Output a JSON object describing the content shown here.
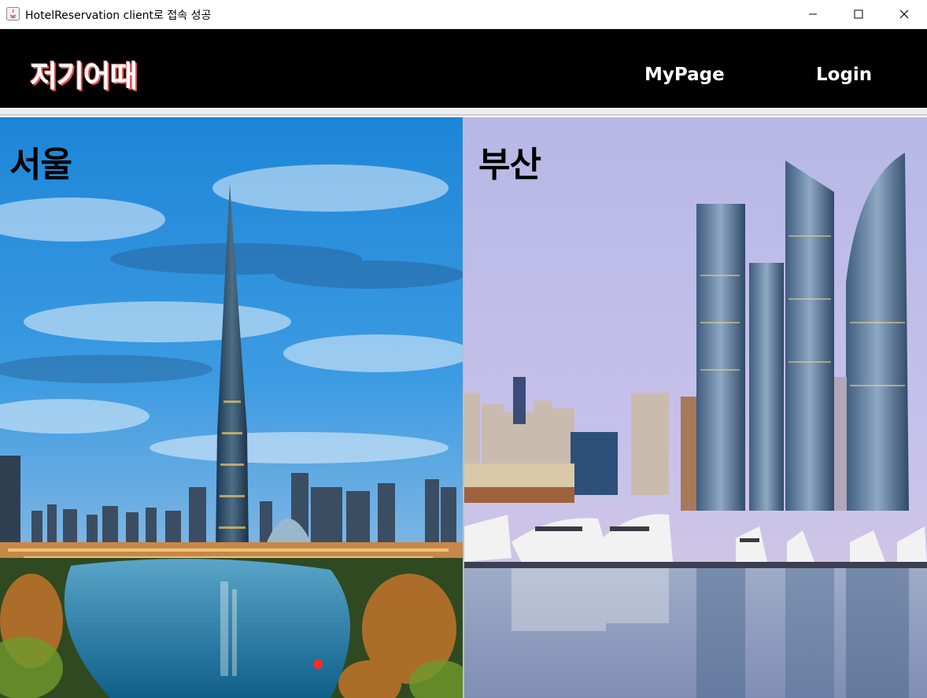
{
  "window": {
    "title": "HotelReservation client로 접속 성공",
    "icon": "java-app-icon",
    "controls": [
      "minimize-icon",
      "maximize-icon",
      "close-icon"
    ]
  },
  "header": {
    "brand": "저기어때",
    "nav": [
      {
        "label": "MyPage"
      },
      {
        "label": "Login"
      }
    ],
    "background": "#000000",
    "brand_accent": "#e25a5a"
  },
  "cities": [
    {
      "name": "서울"
    },
    {
      "name": "부산"
    }
  ]
}
